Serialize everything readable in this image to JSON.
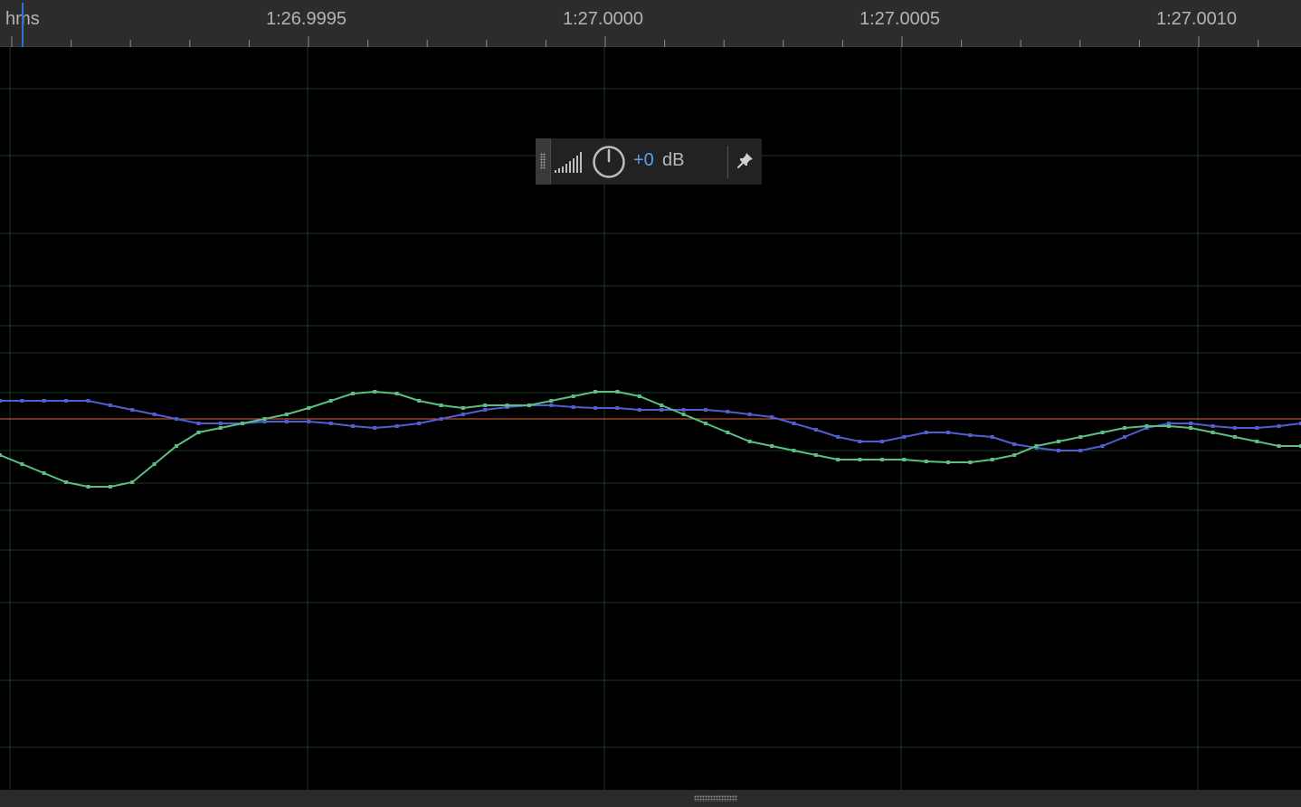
{
  "ruler": {
    "unit_label": "hms",
    "time_labels": [
      "1:26.9995",
      "1:27.0000",
      "1:27.0005",
      "1:27.0010"
    ]
  },
  "hud": {
    "gain_value": "+0",
    "gain_unit": "dB",
    "icons": [
      "grip-handle-icon",
      "volume-level-icon",
      "gain-knob-icon",
      "pin-icon"
    ]
  },
  "colors": {
    "background": "#000000",
    "ruler_background": "#2c2c2c",
    "grid_line": "#1d3a22",
    "channel_1": "#4f5fd0",
    "channel_2": "#5bbf82",
    "center_line": "#b2533a",
    "playhead": "#2f6fd6",
    "accent_value": "#5aa2f0"
  },
  "chart_data": {
    "type": "line",
    "x_axis_ticks": [
      "1:26.9995",
      "1:27.0000",
      "1:27.0005",
      "1:27.0010"
    ],
    "series": [
      {
        "color": "#4f5fd0",
        "values": [
          0.02,
          0.02,
          0.02,
          0.02,
          0.02,
          0.015,
          0.01,
          0.005,
          0.0,
          -0.005,
          -0.005,
          -0.005,
          -0.003,
          -0.003,
          -0.003,
          -0.005,
          -0.008,
          -0.01,
          -0.008,
          -0.005,
          0.0,
          0.005,
          0.01,
          0.013,
          0.015,
          0.015,
          0.013,
          0.012,
          0.012,
          0.01,
          0.01,
          0.01,
          0.01,
          0.008,
          0.005,
          0.002,
          -0.005,
          -0.012,
          -0.02,
          -0.025,
          -0.025,
          -0.02,
          -0.015,
          -0.015,
          -0.018,
          -0.02,
          -0.028,
          -0.032,
          -0.035,
          -0.035,
          -0.03,
          -0.02,
          -0.01,
          -0.005,
          -0.005,
          -0.008,
          -0.01,
          -0.01,
          -0.008,
          -0.005
        ]
      },
      {
        "color": "#5bbf82",
        "values": [
          -0.04,
          -0.05,
          -0.06,
          -0.07,
          -0.075,
          -0.075,
          -0.07,
          -0.05,
          -0.03,
          -0.015,
          -0.01,
          -0.005,
          0.0,
          0.005,
          0.012,
          0.02,
          0.028,
          0.03,
          0.028,
          0.02,
          0.015,
          0.012,
          0.015,
          0.015,
          0.015,
          0.02,
          0.025,
          0.03,
          0.03,
          0.025,
          0.015,
          0.005,
          -0.005,
          -0.015,
          -0.025,
          -0.03,
          -0.035,
          -0.04,
          -0.045,
          -0.045,
          -0.045,
          -0.045,
          -0.047,
          -0.048,
          -0.048,
          -0.045,
          -0.04,
          -0.03,
          -0.025,
          -0.02,
          -0.015,
          -0.01,
          -0.008,
          -0.008,
          -0.01,
          -0.015,
          -0.02,
          -0.025,
          -0.03,
          -0.03
        ]
      }
    ]
  }
}
